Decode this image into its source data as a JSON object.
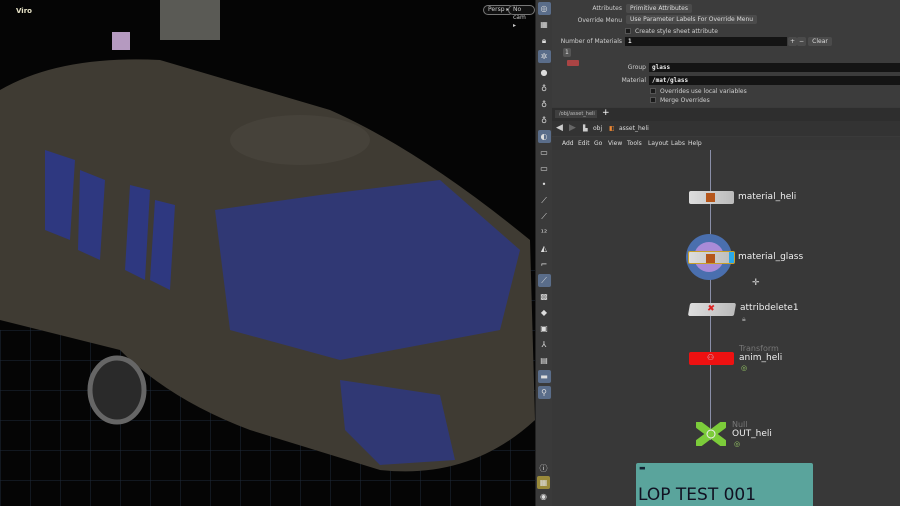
{
  "viewport": {
    "name": "Viro",
    "persp_label": "Persp ▸",
    "cam_label": "No cam ▸"
  },
  "params": {
    "attributes_label": "Attributes",
    "attributes_value": "Primitive Attributes",
    "override_label": "Override Menu",
    "override_value": "Use Parameter Labels For Override Menu",
    "style_sheet_label": "Create style sheet attribute",
    "num_materials_label": "Number of Materials",
    "num_materials_value": "1",
    "plus": "+",
    "minus": "−",
    "clear_label": "Clear",
    "index": "1",
    "group_label": "Group",
    "group_value": "glass",
    "material_label": "Material",
    "material_value": "/mat/glass",
    "overrides_local_label": "Overrides use local variables",
    "merge_overrides_label": "Merge Overrides"
  },
  "tabs": {
    "active": "/obj/asset_heli",
    "add": "+"
  },
  "pathbar": {
    "obj": "obj",
    "asset": "asset_heli"
  },
  "menu": [
    "Add",
    "Edit",
    "Go",
    "View",
    "Tools",
    "Layout",
    "Labs",
    "Help"
  ],
  "nodes": [
    {
      "name": "material_heli",
      "type": ""
    },
    {
      "name": "material_glass",
      "type": ""
    },
    {
      "name": "attribdelete1",
      "type": ""
    },
    {
      "name": "anim_heli",
      "type": "Transform"
    },
    {
      "name": "OUT_heli",
      "type": "Null"
    }
  ],
  "sticky": {
    "text": "LOP TEST 001"
  },
  "colors": {
    "accent": "#5a6d8a",
    "transform_node": "#ee1111",
    "null_node": "#7ccc3a",
    "sticky": "#5aa49c"
  }
}
